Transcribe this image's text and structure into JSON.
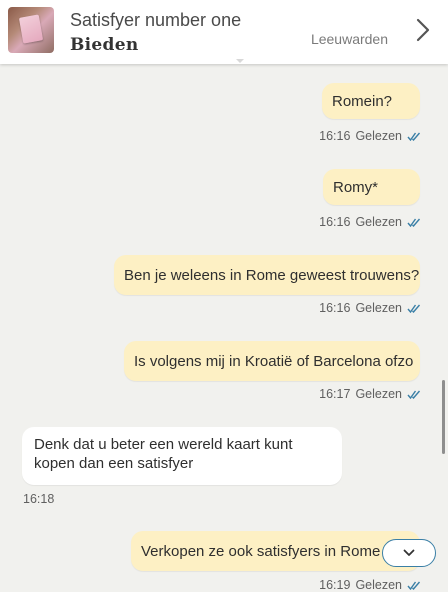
{
  "header": {
    "listing_title": "Satisfyer number one",
    "action_label": "Bieden",
    "location": "Leeuwarden",
    "chevron_icon": "chevron-right-icon"
  },
  "messages": [
    {
      "direction": "out",
      "text": "Romein?",
      "time": "16:16",
      "status": "Gelezen"
    },
    {
      "direction": "out",
      "text": "Romy*",
      "time": "16:16",
      "status": "Gelezen"
    },
    {
      "direction": "out",
      "text": "Ben je weleens in Rome geweest trouwens?",
      "time": "16:16",
      "status": "Gelezen"
    },
    {
      "direction": "out",
      "text": "Is volgens mij in Kroatië of Barcelona ofzo",
      "time": "16:17",
      "status": "Gelezen"
    },
    {
      "direction": "in",
      "text": "Denk dat u beter een wereld kaart kunt kopen dan een satisfyer",
      "time": "16:18"
    },
    {
      "direction": "out",
      "text": "Verkopen ze ook satisfyers in Rome c",
      "time": "16:19",
      "status": "Gelezen"
    }
  ],
  "colors": {
    "outgoing_bubble": "#fdf0c4",
    "incoming_bubble": "#ffffff",
    "read_ticks": "#3a7fa6",
    "background": "#f1f1ee"
  }
}
